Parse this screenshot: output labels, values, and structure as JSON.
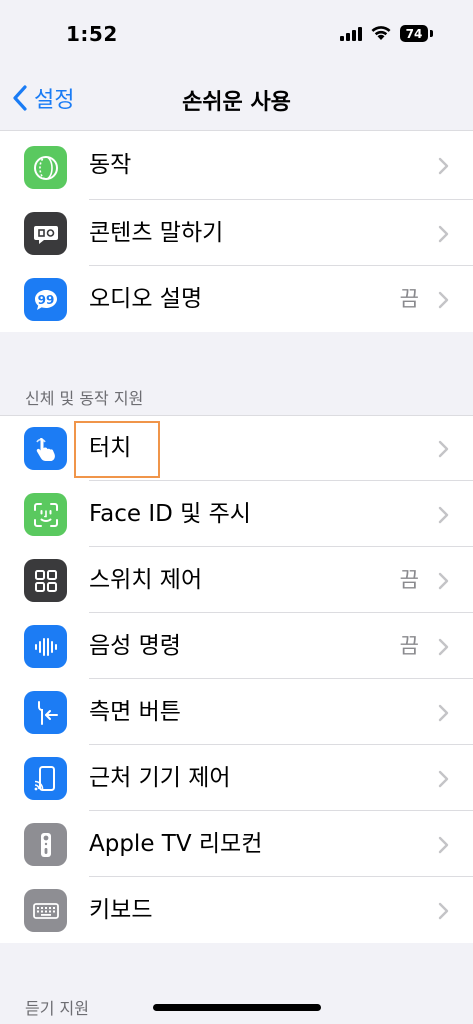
{
  "status_bar": {
    "time": "1:52",
    "battery": "74"
  },
  "nav": {
    "back_label": "설정",
    "title": "손쉬운 사용"
  },
  "vision_group": [
    {
      "label": "동작",
      "value": "",
      "icon": "motion-icon",
      "color": "#5ac95f"
    },
    {
      "label": "콘텐츠 말하기",
      "value": "",
      "icon": "speech-bubble-icon",
      "color": "#3a3a3c"
    },
    {
      "label": "오디오 설명",
      "value": "끔",
      "icon": "audio-description-icon",
      "color": "#1c7cf4"
    }
  ],
  "section_physical": {
    "header": "신체 및 동작 지원"
  },
  "physical_group": [
    {
      "label": "터치",
      "value": "",
      "icon": "touch-hand-icon",
      "color": "#1c7cf4"
    },
    {
      "label": "Face ID 및 주시",
      "value": "",
      "icon": "face-id-icon",
      "color": "#5ac95f"
    },
    {
      "label": "스위치 제어",
      "value": "끔",
      "icon": "switch-control-icon",
      "color": "#3a3a3c"
    },
    {
      "label": "음성 명령",
      "value": "끔",
      "icon": "voice-control-icon",
      "color": "#1c7cf4"
    },
    {
      "label": "측면 버튼",
      "value": "",
      "icon": "side-button-icon",
      "color": "#1c7cf4"
    },
    {
      "label": "근처 기기 제어",
      "value": "",
      "icon": "nearby-devices-icon",
      "color": "#1c7cf4"
    },
    {
      "label": "Apple TV 리모컨",
      "value": "",
      "icon": "apple-tv-remote-icon",
      "color": "#8e8e93"
    },
    {
      "label": "키보드",
      "value": "",
      "icon": "keyboard-icon",
      "color": "#8e8e93"
    }
  ],
  "section_hearing": {
    "header": "듣기 지원"
  }
}
